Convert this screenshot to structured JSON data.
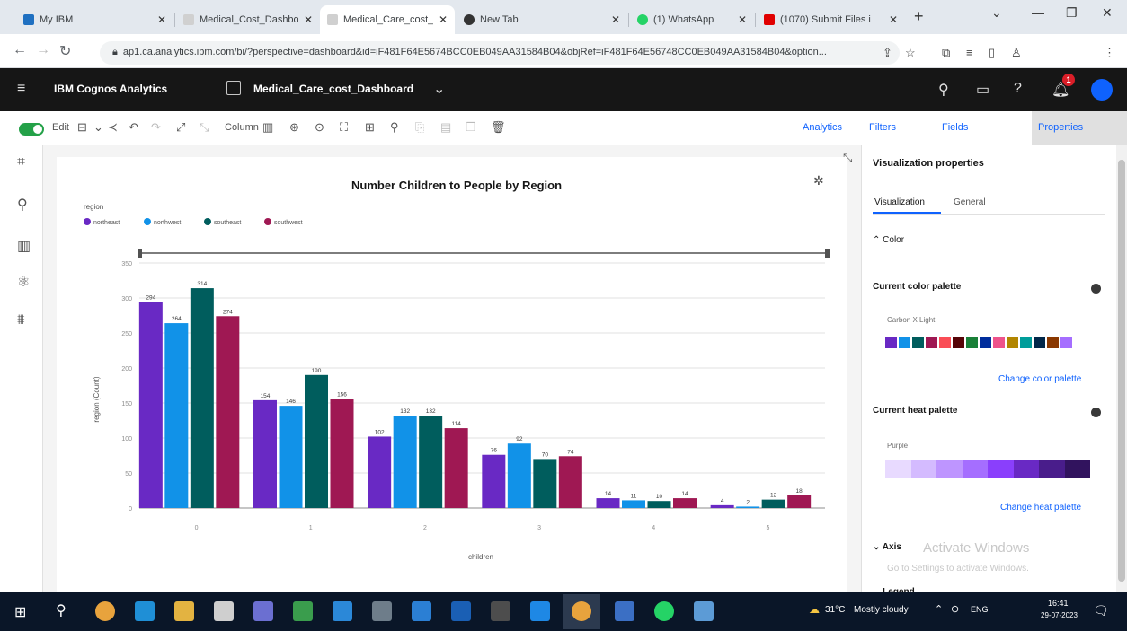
{
  "browser": {
    "tabs": [
      {
        "title": "My IBM",
        "color": "#1f70c1"
      },
      {
        "title": "Medical_Cost_Dashbo",
        "color": "#8a8a8a"
      },
      {
        "title": "Medical_Care_cost_D",
        "color": "#8a8a8a"
      },
      {
        "title": "New Tab",
        "color": "#333333"
      },
      {
        "title": "(1) WhatsApp",
        "color": "#25d366"
      },
      {
        "title": "(1070) Submit Files i",
        "color": "#e00000"
      }
    ],
    "new_tab": "+",
    "url": "ap1.ca.analytics.ibm.com/bi/?perspective=dashboard&id=iF481F64E5674BCC0EB049AA31584B04&objRef=iF481F64E56748CC0EB049AA31584B04&option..."
  },
  "app": {
    "brand": "IBM Cognos Analytics",
    "dashboard_name": "Medical_Care_cost_Dashboard",
    "notification_count": "1"
  },
  "toolbar": {
    "edit_label": "Edit",
    "column_label": "Column",
    "analytics_label": "Analytics",
    "filters_label": "Filters",
    "fields_label": "Fields",
    "properties_label": "Properties"
  },
  "chart_data": {
    "type": "bar",
    "title": "Number Children to People by Region",
    "legend_title": "region",
    "xlabel": "children",
    "ylabel": "region (Count)",
    "ylim": [
      0,
      350
    ],
    "yticks": [
      0,
      50,
      100,
      150,
      200,
      250,
      300,
      350
    ],
    "categories": [
      "0",
      "1",
      "2",
      "3",
      "4",
      "5"
    ],
    "series": [
      {
        "name": "northeast",
        "color": "#6929c4",
        "values": [
          294,
          154,
          102,
          76,
          14,
          4
        ]
      },
      {
        "name": "northwest",
        "color": "#1192e8",
        "values": [
          264,
          146,
          132,
          92,
          11,
          2
        ]
      },
      {
        "name": "southeast",
        "color": "#005d5d",
        "values": [
          314,
          190,
          132,
          70,
          10,
          12
        ]
      },
      {
        "name": "southwest",
        "color": "#9f1853",
        "values": [
          274,
          156,
          114,
          74,
          14,
          18
        ]
      }
    ]
  },
  "properties": {
    "heading": "Visualization properties",
    "tab_visualization": "Visualization",
    "tab_general": "General",
    "color_section": "Color",
    "current_color_palette": "Current color palette",
    "palette_name": "Carbon X Light",
    "palette_colors": [
      "#6929c4",
      "#1192e8",
      "#005d5d",
      "#9f1853",
      "#fa4d56",
      "#570408",
      "#198038",
      "#002d9c",
      "#ee538b",
      "#b28600",
      "#009d9a",
      "#012749",
      "#8a3800",
      "#a56eff"
    ],
    "change_color_palette": "Change color palette",
    "current_heat_palette": "Current heat palette",
    "heat_name": "Purple",
    "heat_colors": [
      "#e8daff",
      "#d4bbff",
      "#be95ff",
      "#a56eff",
      "#8a3ffc",
      "#6929c4",
      "#491d8b",
      "#31135e"
    ],
    "change_heat_palette": "Change heat palette",
    "axis_section": "Axis",
    "legend_section": "Legend"
  },
  "watermark": {
    "line1": "Activate Windows",
    "line2": "Go to Settings to activate Windows."
  },
  "taskbar": {
    "weather_temp": "31°C",
    "weather_text": "Mostly cloudy",
    "lang": "ENG",
    "time": "16:41",
    "date": "29-07-2023"
  }
}
